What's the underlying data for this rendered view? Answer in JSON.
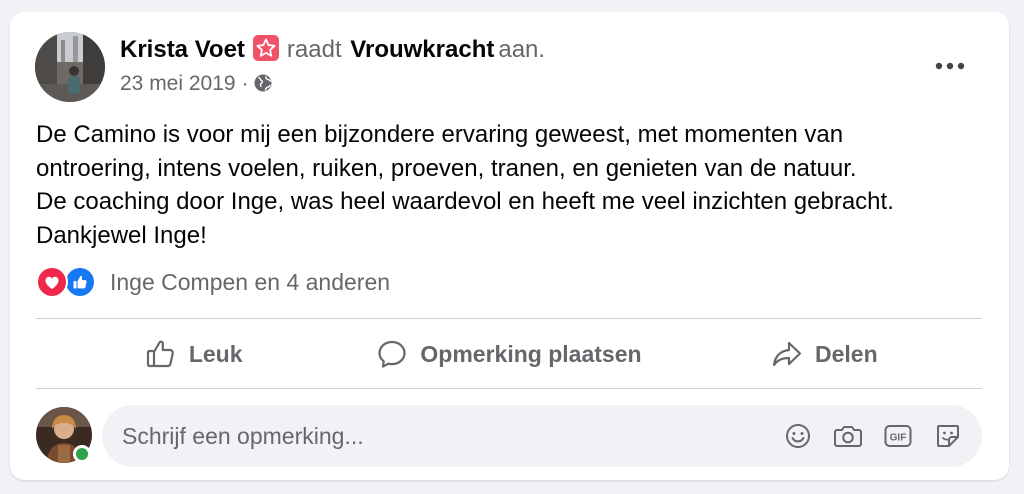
{
  "post": {
    "author": "Krista Voet",
    "author_badge": "star-badge-icon",
    "verb": "raadt",
    "page": "Vrouwkracht",
    "suffix": "aan.",
    "date": "23 mei 2019",
    "separator": "·",
    "privacy_icon": "globe-icon",
    "text_lines": [
      "De Camino is voor mij een bijzondere ervaring geweest, met momenten van",
      "ontroering, intens voelen, ruiken, proeven, tranen, en genieten van de natuur.",
      "De coaching door Inge, was heel waardevol en heeft me veel inzichten gebracht.",
      "Dankjewel Inge!"
    ],
    "reactions_text": "Inge Compen en 4 anderen",
    "reaction_icons": [
      "love-reaction-icon",
      "like-reaction-icon"
    ]
  },
  "actions": {
    "like": "Leuk",
    "comment": "Opmerking plaatsen",
    "share": "Delen"
  },
  "composer": {
    "placeholder": "Schrijf een opmerking...",
    "icons": [
      "emoji-icon",
      "camera-icon",
      "gif-icon",
      "sticker-icon"
    ]
  },
  "colors": {
    "background": "#f0f2f5",
    "text_secondary": "#65676b",
    "love": "#f02849",
    "like": "#1877f2",
    "badge": "#f25268",
    "online": "#31a24c"
  }
}
